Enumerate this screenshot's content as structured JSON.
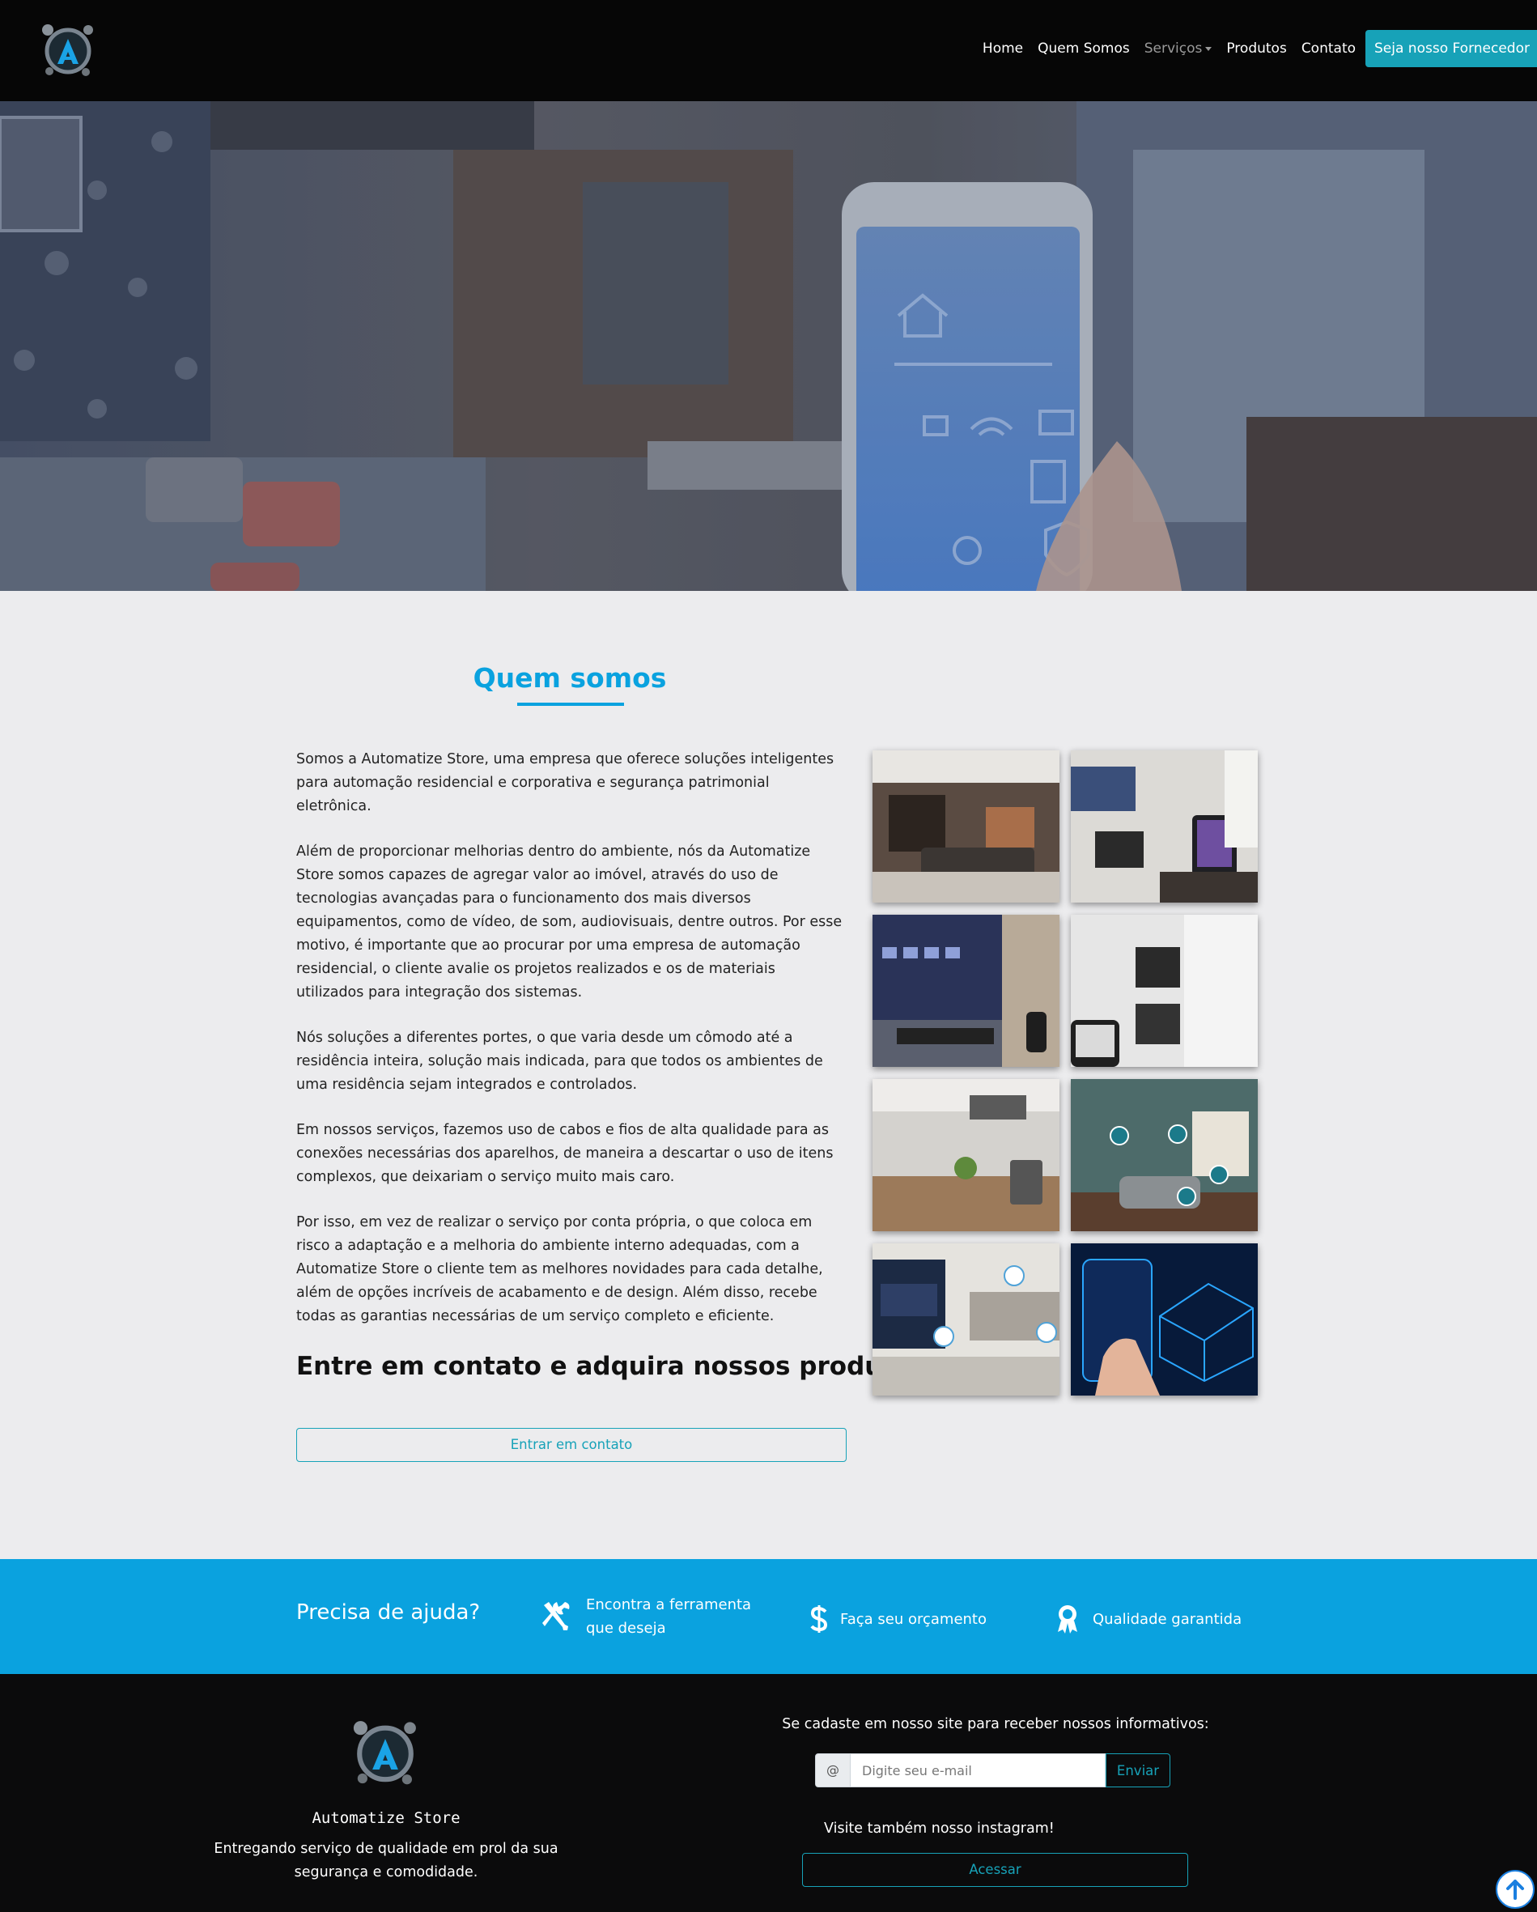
{
  "nav": {
    "logo_alt": "Automatize Store logo",
    "links": [
      "Home",
      "Quem Somos",
      "Serviços",
      "Produtos",
      "Contato"
    ],
    "cta": "Seja nosso Fornecedor",
    "icons": {
      "logo": "automatize-logo-icon",
      "dropdown": "chevron-down-icon"
    },
    "colors": {
      "background": "#060606",
      "cta_bg": "#17a2b8"
    }
  },
  "about": {
    "title": "Quem somos",
    "paragraphs": [
      "Somos a Automatize Store, uma empresa que oferece soluções inteligentes para automação residencial e corporativa e segurança patrimonial eletrônica.",
      "Além de proporcionar melhorias dentro do ambiente, nós da Automatize Store somos capazes de agregar valor ao imóvel, através do uso de tecnologias avançadas para o funcionamento dos mais diversos equipamentos, como de vídeo, de som, audiovisuais, dentre outros. Por esse motivo, é importante que ao procurar por uma empresa de automação residencial, o cliente avalie os projetos realizados e os de materiais utilizados para integração dos sistemas.",
      "Nós soluções a diferentes portes, o que varia desde um cômodo até a residência inteira, solução mais indicada, para que todos os ambientes de uma residência sejam integrados e controlados.",
      "Em nossos serviços, fazemos uso de cabos e fios de alta qualidade para as conexões necessárias dos aparelhos, de maneira a descartar o uso de itens complexos, que deixariam o serviço muito mais caro.",
      "Por isso, em vez de realizar o serviço por conta própria, o que coloca em risco a adaptação e a melhoria do ambiente interno adequadas, com a Automatize Store o cliente tem as melhores novidades para cada detalhe, além de opções incríveis de acabamento e de design. Além disso, recebe todas as garantias necessárias de um serviço completo e eficiente."
    ],
    "cta_heading": "Entre em contato e adquira nossos produtos!",
    "cta_button": "Entrar em contato",
    "accent": "#0aa2df"
  },
  "help": {
    "title": "Precisa de ajuda?",
    "items": [
      {
        "label": "Encontra a ferramenta que deseja",
        "icon": "tools-icon"
      },
      {
        "label": "Faça seu orçamento",
        "icon": "dollar-icon"
      },
      {
        "label": "Qualidade garantida",
        "icon": "award-icon"
      }
    ],
    "background": "#0aa2df"
  },
  "footer": {
    "brand": "Automatize Store",
    "tagline": "Entregando serviço de qualidade em prol da sua segurança e comodidade.",
    "newsletter_label": "Se cadaste em nosso site para receber nossos informativos:",
    "newsletter_prefix": "@",
    "newsletter_placeholder": "Digite seu e-mail",
    "newsletter_button": "Enviar",
    "instagram_label": "Visite também nosso instagram!",
    "instagram_button": "Acessar"
  },
  "scroll_top_icon": "arrow-up-icon"
}
